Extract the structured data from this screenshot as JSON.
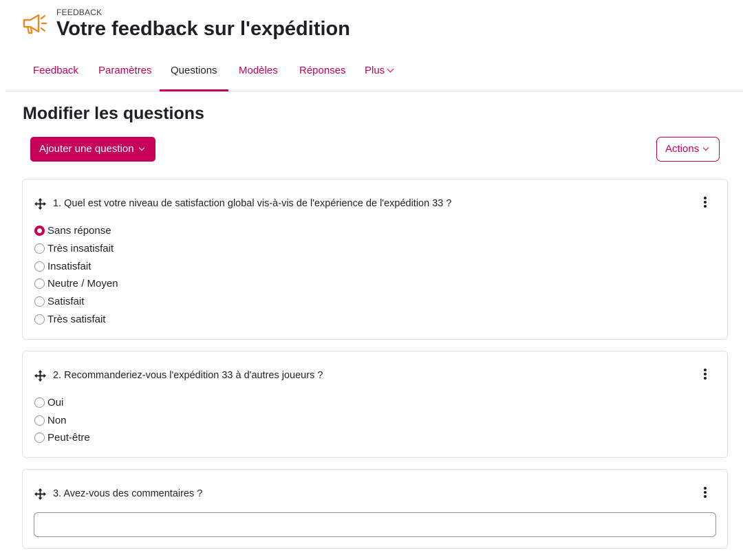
{
  "header": {
    "kicker": "FEEDBACK",
    "title": "Votre feedback sur l'expédition",
    "icon": "megaphone-icon",
    "icon_color": "#f0871e"
  },
  "tabs": [
    {
      "label": "Feedback",
      "active": false
    },
    {
      "label": "Paramètres",
      "active": false
    },
    {
      "label": "Questions",
      "active": true
    },
    {
      "label": "Modèles",
      "active": false
    },
    {
      "label": "Réponses",
      "active": false
    },
    {
      "label": "Plus",
      "active": false
    }
  ],
  "page_title": "Modifier les questions",
  "toolbar": {
    "add_question_label": "Ajouter une question",
    "actions_label": "Actions"
  },
  "colors": {
    "accent": "#c8005a",
    "border": "#dee2e6"
  },
  "questions": [
    {
      "text": "1. Quel est votre niveau de satisfaction global vis-à-vis de l'expérience de l'expédition 33 ?",
      "type": "radio",
      "options": [
        {
          "label": "Sans réponse",
          "selected": true
        },
        {
          "label": "Très insatisfait",
          "selected": false
        },
        {
          "label": "Insatisfait",
          "selected": false
        },
        {
          "label": "Neutre / Moyen",
          "selected": false
        },
        {
          "label": "Satisfait",
          "selected": false
        },
        {
          "label": "Très satisfait",
          "selected": false
        }
      ]
    },
    {
      "text": "2. Recommanderiez-vous l'expédition 33 à d'autres joueurs ?",
      "type": "radio",
      "options": [
        {
          "label": "Oui",
          "selected": false
        },
        {
          "label": "Non",
          "selected": false
        },
        {
          "label": "Peut-être",
          "selected": false
        }
      ]
    },
    {
      "text": "3. Avez-vous des commentaires ?",
      "type": "text",
      "value": ""
    }
  ]
}
